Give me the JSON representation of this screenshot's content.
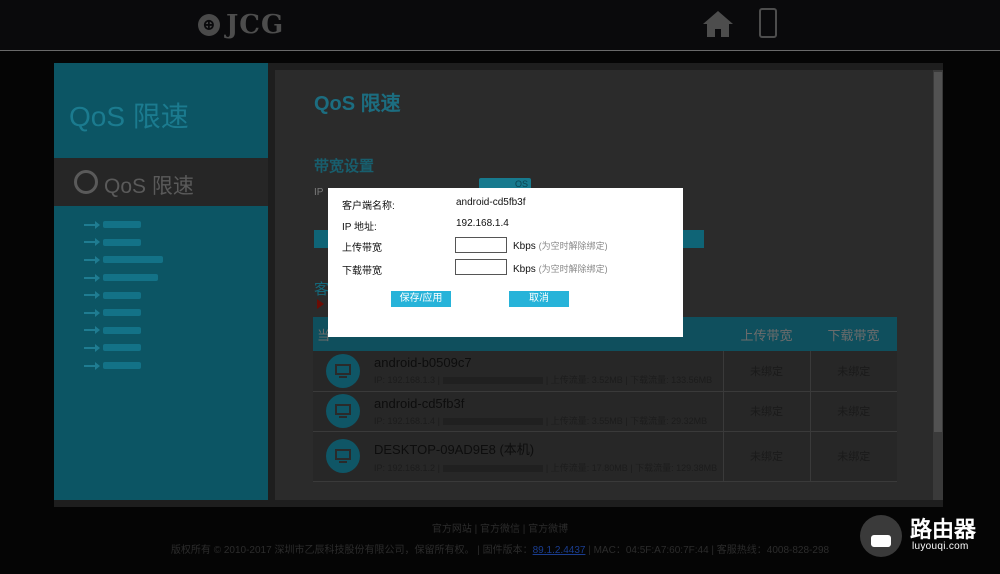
{
  "header": {
    "brand": "JCG",
    "logo_mark": "⊕",
    "icons": [
      "home-icon",
      "mobile-icon"
    ]
  },
  "sidebar": {
    "title": "QoS 限速",
    "active_item": "QoS 限速",
    "menu_item_count": 9
  },
  "main": {
    "page_title": "QoS 限速",
    "section_bandwidth": "带宽设置",
    "ip_label": "IP",
    "toggle_label": "OS",
    "client_section_char": "客",
    "table": {
      "header_first": "当",
      "header_upload": "上传带宽",
      "header_download": "下载带宽",
      "rows": [
        {
          "name": "android-b0509c7",
          "ip": "IP: 192.168.1.3",
          "upload_traffic": "上传流量: 3.52MB",
          "download_traffic": "下载流量: 133.56MB",
          "up": "未绑定",
          "down": "未绑定"
        },
        {
          "name": "android-cd5fb3f",
          "ip": "IP: 192.168.1.4",
          "upload_traffic": "上传流量: 3.55MB",
          "download_traffic": "下载流量: 29.32MB",
          "up": "未绑定",
          "down": "未绑定"
        },
        {
          "name": "DESKTOP-09AD9E8 (本机)",
          "ip": "IP: 192.168.1.2",
          "upload_traffic": "上传流量: 17.80MB",
          "download_traffic": "下载流量: 129.38MB",
          "up": "未绑定",
          "down": "未绑定"
        }
      ]
    }
  },
  "dialog": {
    "client_name_label": "客户端名称:",
    "client_name_value": "android-cd5fb3f",
    "ip_label": "IP 地址:",
    "ip_value": "192.168.1.4",
    "upload_label": "上传带宽",
    "download_label": "下载带宽",
    "upload_value": "",
    "download_value": "",
    "unit": "Kbps",
    "hint": "(为空时解除绑定)",
    "save_label": "保存/应用",
    "cancel_label": "取消"
  },
  "footer": {
    "links": "官方网站 | 官方微信 | 官方微博",
    "copyright": "版权所有 © 2010-2017 深圳市乙辰科技股份有限公司，保留所有权。 | 固件版本：",
    "firmware": "89.1.2.4437",
    "mac_and_hotline": " | MAC：04:5F:A7:60:7F:44 | 客服热线：4008-828-298"
  },
  "watermark": {
    "cn": "路由器",
    "en": "luyouqi.com"
  },
  "colors": {
    "accent": "#27b3d9",
    "sidebar": "#0c5564",
    "overlay": "#050505"
  }
}
